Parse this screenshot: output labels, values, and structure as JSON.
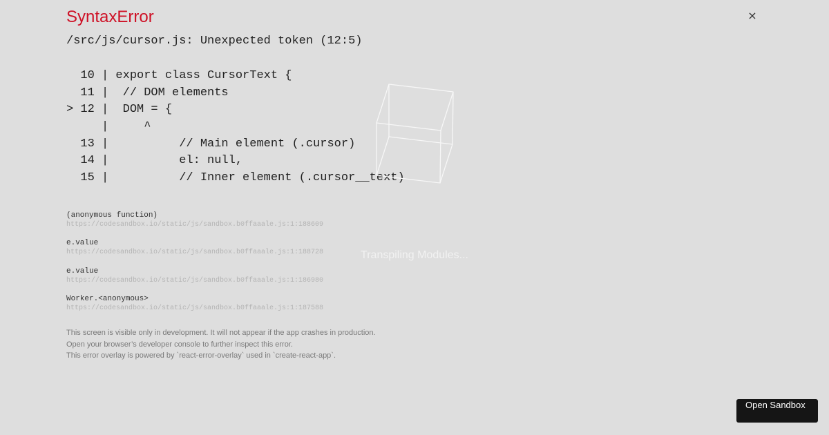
{
  "error": {
    "title": "SyntaxError",
    "message": "/src/js/cursor.js: Unexpected token (12:5)",
    "close_glyph": "×"
  },
  "code_frame": [
    "  10 | export class CursorText {",
    "  11 |  // DOM elements",
    "> 12 |  DOM = {",
    "     |     ^",
    "  13 |          // Main element (.cursor)",
    "  14 |          el: null,",
    "  15 |          // Inner element (.cursor__text)"
  ],
  "stack_frames": [
    {
      "function": "(anonymous function)",
      "location": "https://codesandbox.io/static/js/sandbox.b0ffaaale.js:1:188609"
    },
    {
      "function": "e.value",
      "location": "https://codesandbox.io/static/js/sandbox.b0ffaaale.js:1:188728"
    },
    {
      "function": "e.value",
      "location": "https://codesandbox.io/static/js/sandbox.b0ffaaale.js:1:186980"
    },
    {
      "function": "Worker.<anonymous>",
      "location": "https://codesandbox.io/static/js/sandbox.b0ffaaale.js:1:187588"
    }
  ],
  "footer_notes": [
    "This screen is visible only in development. It will not appear if the app crashes in production.",
    "Open your browser’s developer console to further inspect this error.",
    "This error overlay is powered by `react-error-overlay` used in `create-react-app`."
  ],
  "loader": {
    "text": "Transpiling Modules...",
    "icon": "cube-icon"
  },
  "open_sandbox_button": {
    "label": "Open Sandbox"
  },
  "colors": {
    "background": "#dedede",
    "error_title": "#ce1126",
    "button_background": "#151515"
  }
}
